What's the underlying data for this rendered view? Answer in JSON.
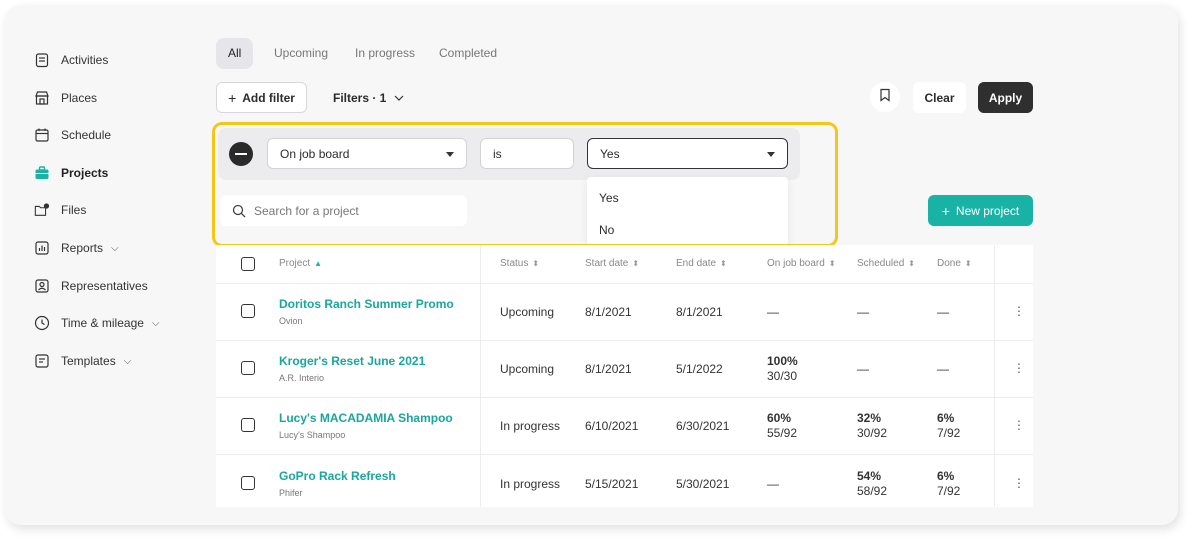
{
  "sidebar": {
    "items": [
      {
        "label": "Activities",
        "icon": "clipboard-icon"
      },
      {
        "label": "Places",
        "icon": "store-icon"
      },
      {
        "label": "Schedule",
        "icon": "calendar-icon"
      },
      {
        "label": "Projects",
        "icon": "briefcase-icon"
      },
      {
        "label": "Files",
        "icon": "folder-icon"
      },
      {
        "label": "Reports",
        "icon": "chart-icon"
      },
      {
        "label": "Representatives",
        "icon": "user-icon"
      },
      {
        "label": "Time & mileage",
        "icon": "clock-icon"
      },
      {
        "label": "Templates",
        "icon": "template-icon"
      }
    ]
  },
  "tabs": [
    "All",
    "Upcoming",
    "In progress",
    "Completed"
  ],
  "toolbar": {
    "add_filter": "Add filter",
    "filters": "Filters · 1",
    "clear": "Clear",
    "apply": "Apply"
  },
  "filter": {
    "field": "On job board",
    "operator": "is",
    "value": "Yes",
    "options": [
      "Yes",
      "No"
    ]
  },
  "search": {
    "placeholder": "Search for a project"
  },
  "new_project": "New project",
  "table": {
    "headers": [
      "Project",
      "Status",
      "Start date",
      "End date",
      "On job board",
      "Scheduled",
      "Done"
    ],
    "rows": [
      {
        "name": "Doritos Ranch Summer Promo",
        "client": "Ovion",
        "status": "Upcoming",
        "start": "8/1/2021",
        "end": "8/1/2021",
        "job_pct": "—",
        "job_frac": "",
        "sched_pct": "—",
        "sched_frac": "",
        "done_pct": "—",
        "done_frac": ""
      },
      {
        "name": "Kroger's Reset June 2021",
        "client": "A.R. Interio",
        "status": "Upcoming",
        "start": "8/1/2021",
        "end": "5/1/2022",
        "job_pct": "100%",
        "job_frac": "30/30",
        "sched_pct": "—",
        "sched_frac": "",
        "done_pct": "—",
        "done_frac": ""
      },
      {
        "name": "Lucy's MACADAMIA Shampoo",
        "client": "Lucy's Shampoo",
        "status": "In progress",
        "start": "6/10/2021",
        "end": "6/30/2021",
        "job_pct": "60%",
        "job_frac": "55/92",
        "sched_pct": "32%",
        "sched_frac": "30/92",
        "done_pct": "6%",
        "done_frac": "7/92"
      },
      {
        "name": "GoPro Rack Refresh",
        "client": "Phifer",
        "status": "In progress",
        "start": "5/15/2021",
        "end": "5/30/2021",
        "job_pct": "—",
        "job_frac": "",
        "sched_pct": "54%",
        "sched_frac": "58/92",
        "done_pct": "6%",
        "done_frac": "7/92"
      }
    ]
  },
  "colors": {
    "accent": "#19b3a6",
    "highlight": "#f5c518",
    "dark": "#2f2f2f"
  }
}
